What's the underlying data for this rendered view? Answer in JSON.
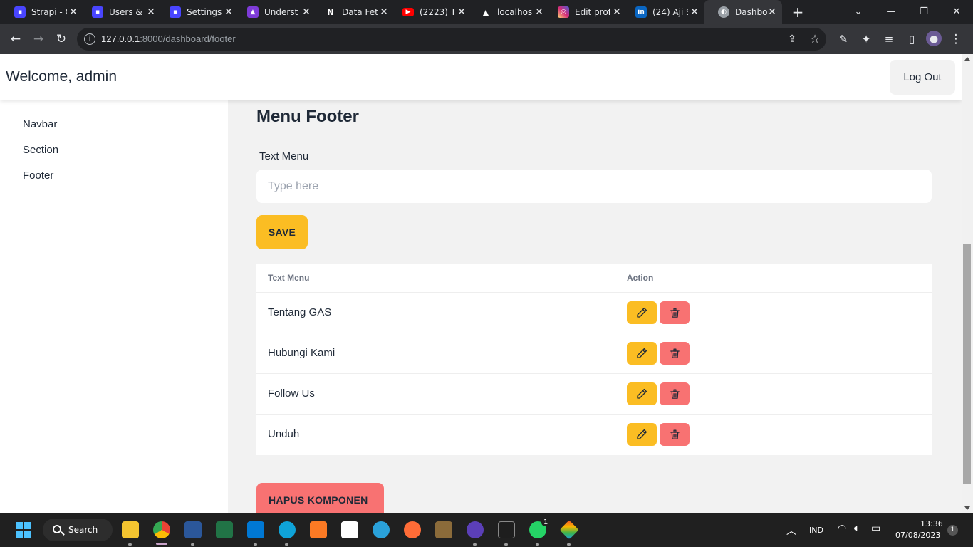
{
  "browser": {
    "tabs": [
      {
        "title": "Strapi - C",
        "icon": "strapi-icon",
        "color": "#4945ff"
      },
      {
        "title": "Users &",
        "icon": "strapi-icon",
        "color": "#4945ff"
      },
      {
        "title": "Settings",
        "icon": "strapi-icon",
        "color": "#4945ff"
      },
      {
        "title": "Underst",
        "icon": "astro-icon",
        "color": "#7e3bd8"
      },
      {
        "title": "Data Fet",
        "icon": "nextjs-icon",
        "color": "#202124"
      },
      {
        "title": "(2223) T",
        "icon": "youtube-icon",
        "color": "#ff0000"
      },
      {
        "title": "localhos",
        "icon": "vercel-icon",
        "color": "#202124"
      },
      {
        "title": "Edit prof",
        "icon": "instagram-icon",
        "color": "#d62976"
      },
      {
        "title": "(24) Aji S",
        "icon": "linkedin-icon",
        "color": "#0a66c2"
      },
      {
        "title": "Dashbo",
        "icon": "globe-icon",
        "color": "#9aa0a6"
      }
    ],
    "url_host": "127.0.0.1",
    "url_path": ":8000/dashboard/footer"
  },
  "header": {
    "welcome": "Welcome, admin",
    "logout_label": "Log Out"
  },
  "sidebar": {
    "items": [
      {
        "label": "Navbar"
      },
      {
        "label": "Section"
      },
      {
        "label": "Footer"
      }
    ]
  },
  "main": {
    "title": "Menu Footer",
    "field_label": "Text Menu",
    "input_placeholder": "Type here",
    "input_value": "",
    "save_label": "SAVE",
    "table": {
      "columns": [
        "Text Menu",
        "Action"
      ],
      "rows": [
        {
          "text": "Tentang GAS"
        },
        {
          "text": "Hubungi Kami"
        },
        {
          "text": "Follow Us"
        },
        {
          "text": "Unduh"
        }
      ]
    },
    "delete_component_label": "HAPUS KOMPONEN"
  },
  "taskbar": {
    "search_label": "Search",
    "language": "IND",
    "time": "13:36",
    "date": "07/08/2023",
    "notification_count": "1",
    "whatsapp_badge": "1"
  },
  "colors": {
    "warning": "#fbbd23",
    "error": "#f87272",
    "page_bg": "#f2f2f2"
  }
}
